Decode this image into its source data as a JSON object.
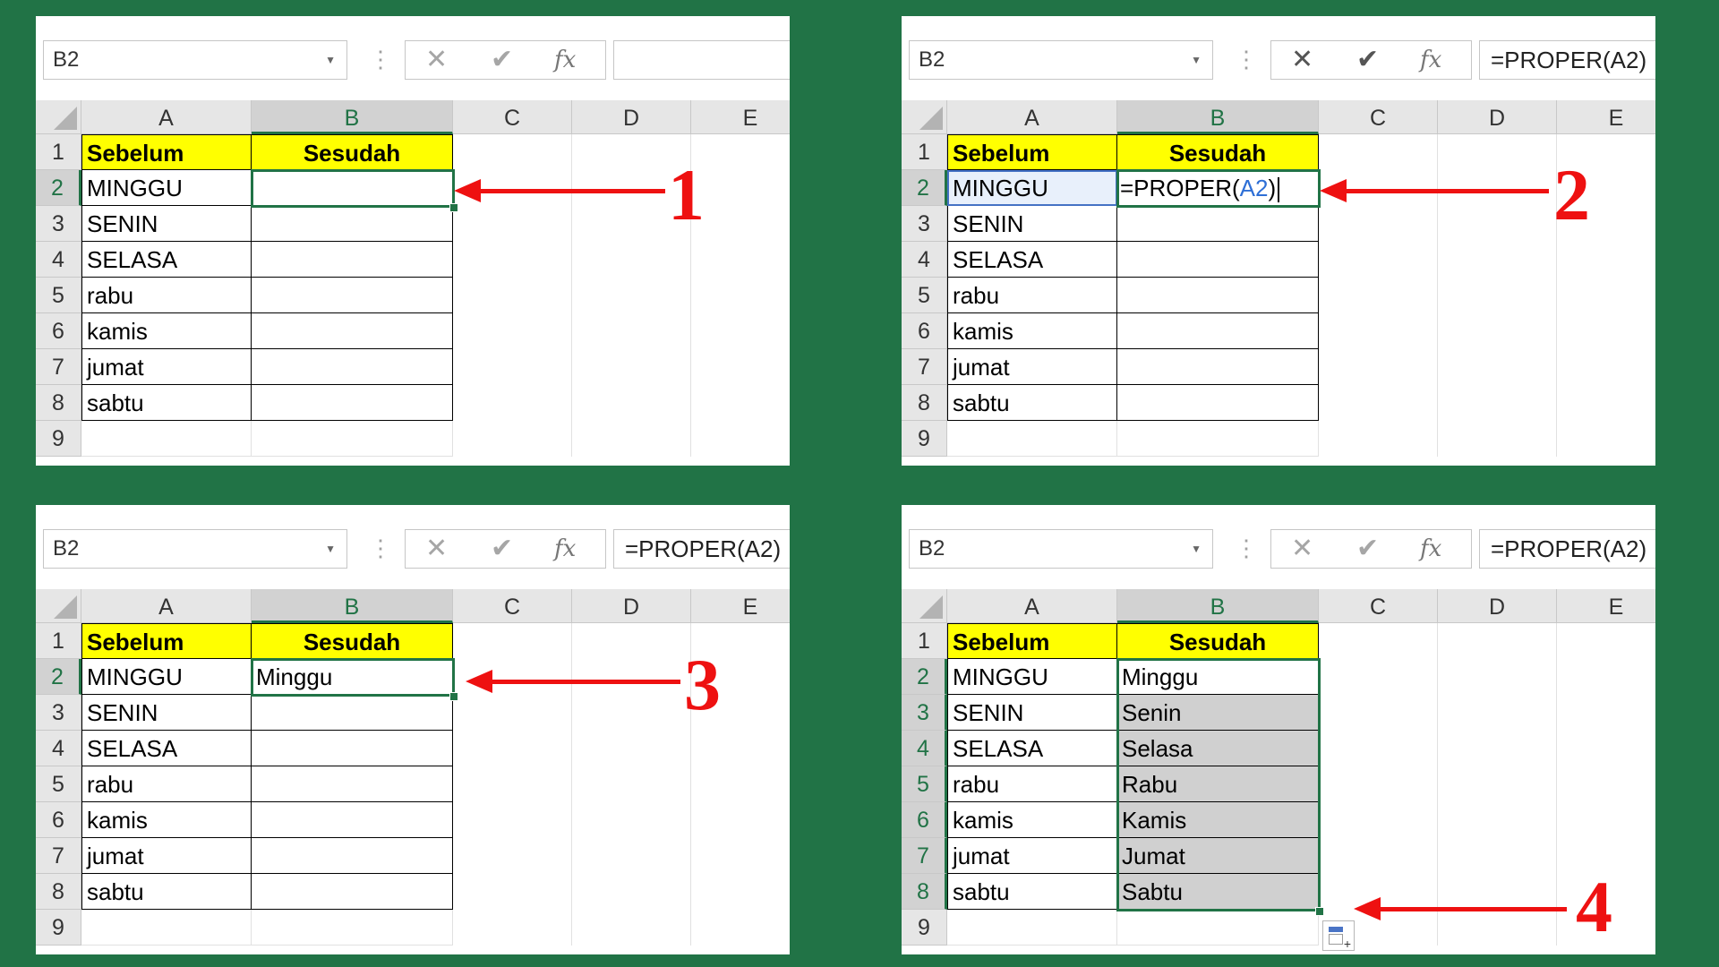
{
  "panels": [
    {
      "id": "1",
      "name_box": "B2",
      "formula": "",
      "columns": [
        "A",
        "B",
        "C",
        "D",
        "E"
      ],
      "rows": [
        "1",
        "2",
        "3",
        "4",
        "5",
        "6",
        "7",
        "8",
        "9"
      ],
      "col_a": [
        "Sebelum",
        "MINGGU",
        "SENIN",
        "SELASA",
        "rabu",
        "kamis",
        "jumat",
        "sabtu",
        ""
      ],
      "col_b": [
        "Sesudah",
        "",
        "",
        "",
        "",
        "",
        "",
        "",
        ""
      ],
      "step": "1"
    },
    {
      "id": "2",
      "name_box": "B2",
      "formula": "=PROPER(A2)",
      "columns": [
        "A",
        "B",
        "C",
        "D",
        "E"
      ],
      "rows": [
        "1",
        "2",
        "3",
        "4",
        "5",
        "6",
        "7",
        "8",
        "9"
      ],
      "col_a": [
        "Sebelum",
        "MINGGU",
        "SENIN",
        "SELASA",
        "rabu",
        "kamis",
        "jumat",
        "sabtu",
        ""
      ],
      "col_b": [
        "Sesudah",
        "",
        "",
        "",
        "",
        "",
        "",
        "",
        ""
      ],
      "edit_cell": {
        "prefix": "=PROPER(",
        "ref": "A2",
        "suffix": ")"
      },
      "step": "2"
    },
    {
      "id": "3",
      "name_box": "B2",
      "formula": "=PROPER(A2)",
      "columns": [
        "A",
        "B",
        "C",
        "D",
        "E"
      ],
      "rows": [
        "1",
        "2",
        "3",
        "4",
        "5",
        "6",
        "7",
        "8",
        "9"
      ],
      "col_a": [
        "Sebelum",
        "MINGGU",
        "SENIN",
        "SELASA",
        "rabu",
        "kamis",
        "jumat",
        "sabtu",
        ""
      ],
      "col_b": [
        "Sesudah",
        "Minggu",
        "",
        "",
        "",
        "",
        "",
        "",
        ""
      ],
      "step": "3"
    },
    {
      "id": "4",
      "name_box": "B2",
      "formula": "=PROPER(A2)",
      "columns": [
        "A",
        "B",
        "C",
        "D",
        "E"
      ],
      "rows": [
        "1",
        "2",
        "3",
        "4",
        "5",
        "6",
        "7",
        "8",
        "9"
      ],
      "col_a": [
        "Sebelum",
        "MINGGU",
        "SENIN",
        "SELASA",
        "rabu",
        "kamis",
        "jumat",
        "sabtu",
        ""
      ],
      "col_b": [
        "Sesudah",
        "Minggu",
        "Senin",
        "Selasa",
        "Rabu",
        "Kamis",
        "Jumat",
        "Sabtu",
        ""
      ],
      "step": "4"
    }
  ],
  "icons": {
    "cancel": "close-icon",
    "enter": "check-icon",
    "insert_function": "fx-icon",
    "name_box_dropdown": "chevron-down-icon",
    "autofill_options": "autofill-options-icon"
  },
  "colors": {
    "background": "#217346",
    "header_fill": "#ffff00",
    "selection": "#217346",
    "arrow": "#ee1111",
    "fill_shade": "#d0d0d0",
    "reference": "#4472c4"
  }
}
